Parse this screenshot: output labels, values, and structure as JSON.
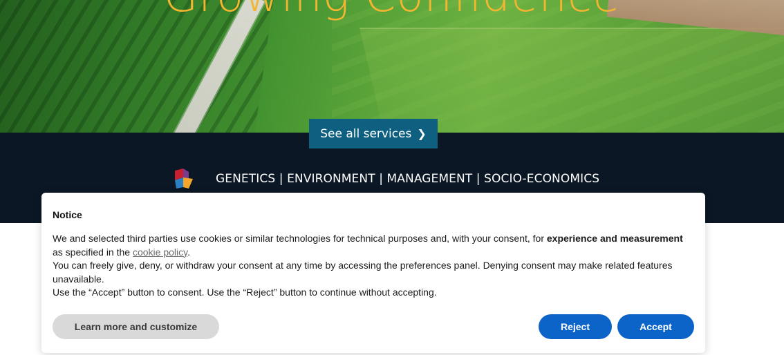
{
  "hero": {
    "title": "Growing Confidence",
    "services_button": "See all services",
    "services_button_icon": "chevron-right-icon",
    "colors": {
      "title": "#f4b531",
      "button": "#0e5f80"
    }
  },
  "band": {
    "tagline": "GENETICS | ENVIRONMENT | MANAGEMENT | SOCIO-ECONOMICS",
    "logo_icon": "cube-logo-icon",
    "background": "#0b1724"
  },
  "notice": {
    "title": "Notice",
    "line1_pre": "We and selected third parties use cookies or similar technologies for technical purposes and, with your consent, for ",
    "line1_bold": "experience and measurement",
    "line1_post": " as specified in the ",
    "cookie_link": "cookie policy",
    "line1_end": ".",
    "line2": "You can freely give, deny, or withdraw your consent at any time by accessing the preferences panel. Denying consent may make related features unavailable.",
    "line3": "Use the “Accept” button to consent. Use the “Reject” button to continue without accepting.",
    "buttons": {
      "learn_more": "Learn more and customize",
      "reject": "Reject",
      "accept": "Accept"
    },
    "accent": "#0c64c8"
  }
}
